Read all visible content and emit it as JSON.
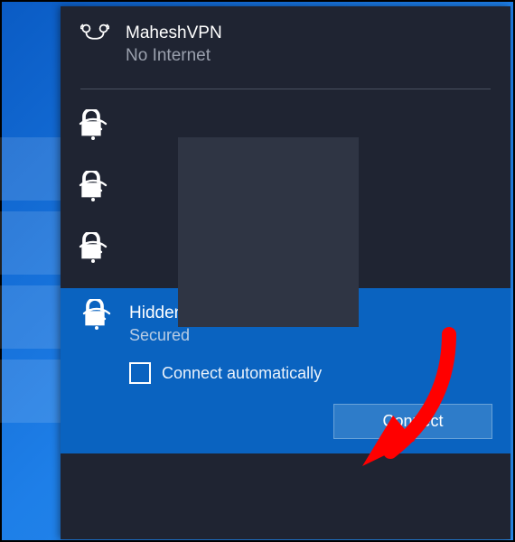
{
  "vpn": {
    "name": "MaheshVPN",
    "status": "No Internet",
    "icon": "vpn-icon"
  },
  "wifi_items": [
    {
      "secured": true,
      "icon": "wifi-secure-icon"
    },
    {
      "secured": true,
      "icon": "wifi-secure-icon"
    },
    {
      "secured": true,
      "icon": "wifi-secure-icon"
    }
  ],
  "selected_network": {
    "name": "Hidden Network",
    "status": "Secured",
    "auto_connect_label": "Connect automatically",
    "auto_connect_checked": false,
    "connect_label": "Connect",
    "icon": "wifi-secure-icon"
  },
  "colors": {
    "panel_bg": "#1f2432",
    "selected_bg": "#0a63c0",
    "accent_btn": "#2e7cc9"
  },
  "annotation": {
    "type": "arrow",
    "color": "#ff0000",
    "target": "connect-button"
  }
}
